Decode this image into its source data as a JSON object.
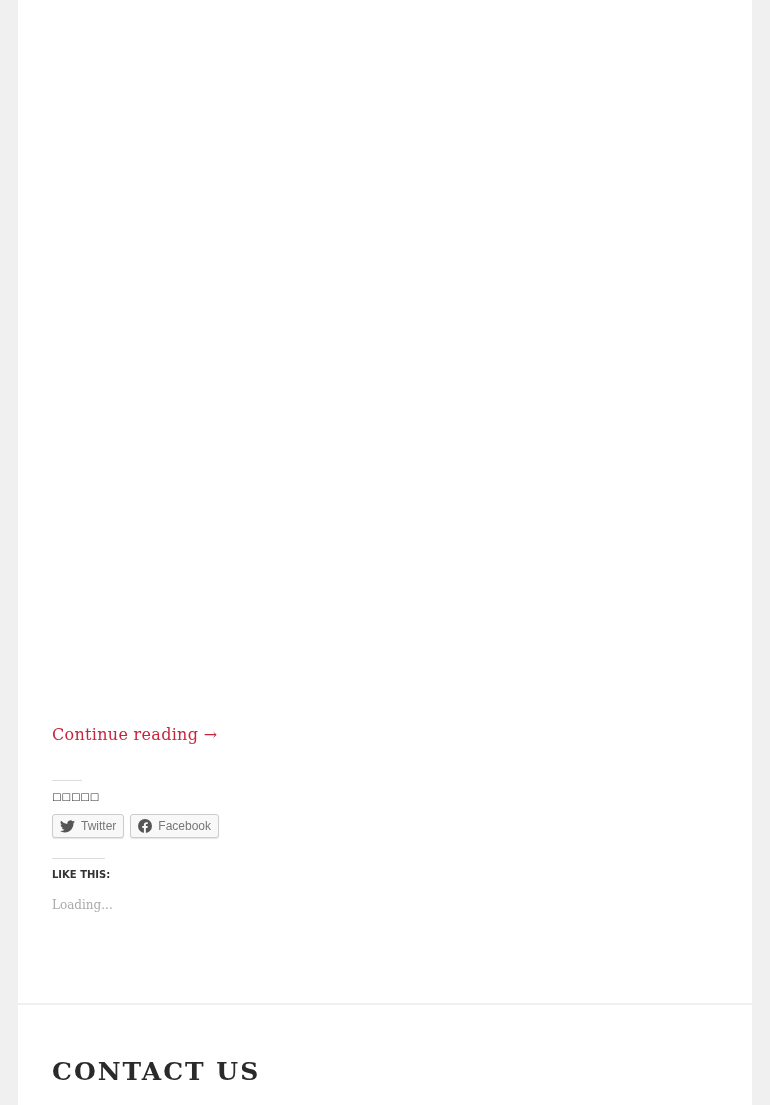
{
  "post": {
    "continue_link": "Continue reading →",
    "share": {
      "heading": "□□□□□",
      "buttons": [
        {
          "kind": "twitter",
          "label": "Twitter"
        },
        {
          "kind": "facebook",
          "label": "Facebook"
        }
      ]
    },
    "likes": {
      "heading": "LIKE THIS:",
      "status": "Loading..."
    }
  },
  "widget": {
    "title": "CONTACT US"
  }
}
